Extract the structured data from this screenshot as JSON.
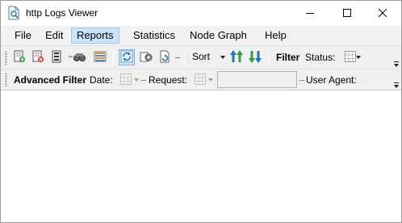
{
  "window": {
    "title": "http Logs Viewer"
  },
  "menu": {
    "items": [
      {
        "label": "File"
      },
      {
        "label": "Edit"
      },
      {
        "label": "Reports",
        "active": true
      },
      {
        "label": "Statistics"
      },
      {
        "label": "Node Graph"
      },
      {
        "label": "Help"
      }
    ]
  },
  "toolbar": {
    "sort_label": "Sort",
    "filter_label": "Filter",
    "status_label": "Status:",
    "icons": [
      "add-log-icon",
      "remove-log-icon",
      "document-list-icon",
      "binoculars-icon",
      "column-list-icon",
      "refresh-icon",
      "gear-settings-icon",
      "document-refresh-icon",
      "sort-ascending-icon",
      "sort-descending-icon",
      "grid-icon"
    ]
  },
  "filter_bar": {
    "title": "Advanced Filter",
    "date_label": "Date:",
    "request_label": "Request:",
    "user_agent_label": "User Agent:",
    "user_agent_value": ""
  },
  "colors": {
    "menu_active_bg": "#cce4f7",
    "toolbar_bg": "#f0f0f0",
    "refresh_blue": "#1e73be",
    "sort_up_green": "#2e9e3a",
    "sort_down_green": "#2e9e3a"
  }
}
